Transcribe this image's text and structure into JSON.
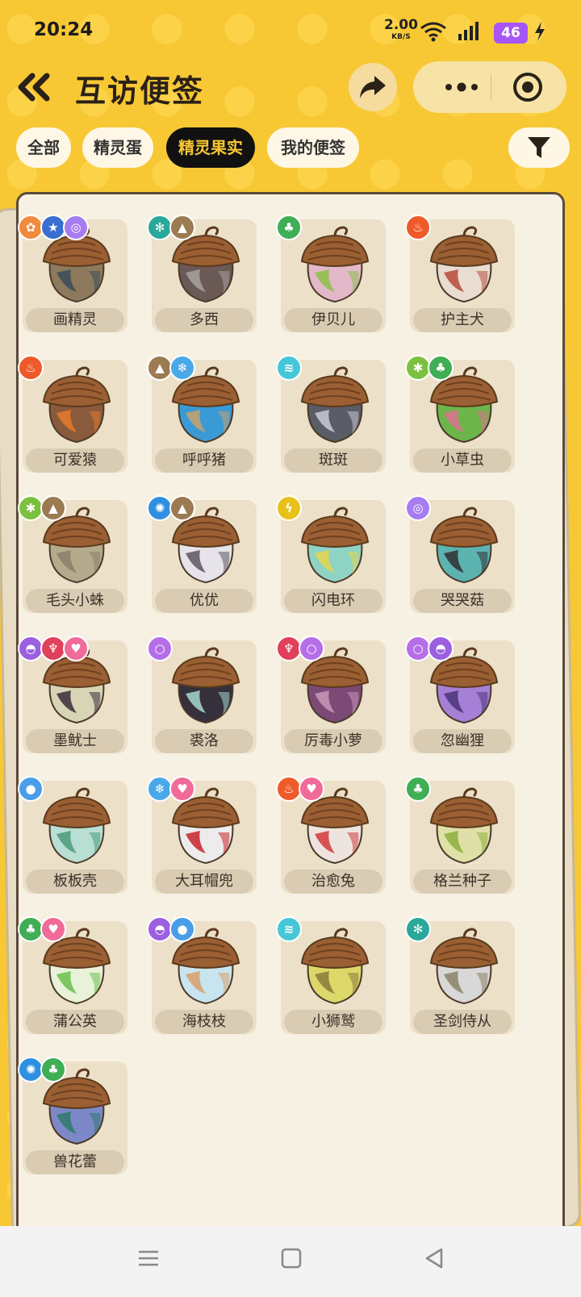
{
  "status": {
    "time": "20:24",
    "speed": "2.00",
    "speed_unit": "KB/S",
    "battery": "46"
  },
  "header": {
    "title": "互访便签"
  },
  "tabs": [
    {
      "label": "全部",
      "active": false
    },
    {
      "label": "精灵蛋",
      "active": false
    },
    {
      "label": "精灵果实",
      "active": true
    },
    {
      "label": "我的便签",
      "active": false
    }
  ],
  "colors": {
    "accent": "#f8c834",
    "active_tab_bg": "#111111",
    "active_tab_text": "#f8c834"
  },
  "items": [
    {
      "name": "画精灵",
      "badges": [
        "orange-badge",
        "blue-star",
        "purple-swirl"
      ],
      "body": "#8d7a5c",
      "accent": "#3b4c59"
    },
    {
      "name": "多西",
      "badges": [
        "teal-gear",
        "brown-mountain"
      ],
      "body": "#6b5955",
      "accent": "#a8a2a0"
    },
    {
      "name": "伊贝儿",
      "badges": [
        "green-leaf"
      ],
      "body": "#e3b8c8",
      "accent": "#8cc04a"
    },
    {
      "name": "护主犬",
      "badges": [
        "orange-fire"
      ],
      "body": "#e8ddd0",
      "accent": "#b74a3c"
    },
    {
      "name": "可爱猿",
      "badges": [
        "orange-fire"
      ],
      "body": "#8a5a3c",
      "accent": "#e67a2c"
    },
    {
      "name": "呼呼猪",
      "badges": [
        "brown-mountain",
        "blue-snow"
      ],
      "body": "#3a9ad6",
      "accent": "#c9a26a"
    },
    {
      "name": "斑斑",
      "badges": [
        "cyan-wing"
      ],
      "body": "#5a5c66",
      "accent": "#c8cbd6"
    },
    {
      "name": "小草虫",
      "badges": [
        "green-bug",
        "green-leaf"
      ],
      "body": "#6db54a",
      "accent": "#e07090"
    },
    {
      "name": "毛头小蛛",
      "badges": [
        "green-bug",
        "brown-mountain"
      ],
      "body": "#b5aa8c",
      "accent": "#8a7f68"
    },
    {
      "name": "优优",
      "badges": [
        "blue-gear",
        "brown-mountain"
      ],
      "body": "#e6e4ea",
      "accent": "#5b5660"
    },
    {
      "name": "闪电环",
      "badges": [
        "yellow-bolt"
      ],
      "body": "#8fd3c4",
      "accent": "#e8d64a"
    },
    {
      "name": "哭哭菇",
      "badges": [
        "purple-swirl"
      ],
      "body": "#5cb3b0",
      "accent": "#2f2f33"
    },
    {
      "name": "墨鱿士",
      "badges": [
        "purple-ghost",
        "red-demon",
        "pink-heart"
      ],
      "body": "#d8d4b6",
      "accent": "#3a2a3a"
    },
    {
      "name": "裘洛",
      "badges": [
        "purple-bubble"
      ],
      "body": "#35303c",
      "accent": "#a5d8cc"
    },
    {
      "name": "厉毒小萝",
      "badges": [
        "red-demon",
        "purple-bubble"
      ],
      "body": "#7c4a76",
      "accent": "#c998b8"
    },
    {
      "name": "忽幽狸",
      "badges": [
        "purple-bubble",
        "purple-ghost"
      ],
      "body": "#a67fd6",
      "accent": "#4a3478"
    },
    {
      "name": "板板壳",
      "badges": [
        "blue-drop"
      ],
      "body": "#b9ded4",
      "accent": "#4a9a7a"
    },
    {
      "name": "大耳帽兜",
      "badges": [
        "blue-snow",
        "pink-heart"
      ],
      "body": "#ececec",
      "accent": "#c8242c"
    },
    {
      "name": "治愈兔",
      "badges": [
        "orange-fire",
        "pink-heart"
      ],
      "body": "#ede4e0",
      "accent": "#d23a3a"
    },
    {
      "name": "格兰种子",
      "badges": [
        "green-leaf"
      ],
      "body": "#dfe0a8",
      "accent": "#8cae3c"
    },
    {
      "name": "蒲公英",
      "badges": [
        "green-leaf",
        "pink-heart"
      ],
      "body": "#e8f2d8",
      "accent": "#6ac04a"
    },
    {
      "name": "海枝枝",
      "badges": [
        "purple-ghost",
        "blue-drop"
      ],
      "body": "#c8e4ef",
      "accent": "#d8a06a"
    },
    {
      "name": "小狮鹫",
      "badges": [
        "cyan-wing"
      ],
      "body": "#dcd86a",
      "accent": "#8a7a3a"
    },
    {
      "name": "圣剑侍从",
      "badges": [
        "teal-gear"
      ],
      "body": "#d8d8d8",
      "accent": "#8a8268"
    },
    {
      "name": "兽花蕾",
      "badges": [
        "blue-gear",
        "green-leaf"
      ],
      "body": "#7c88c8",
      "accent": "#2e7a6a"
    }
  ]
}
